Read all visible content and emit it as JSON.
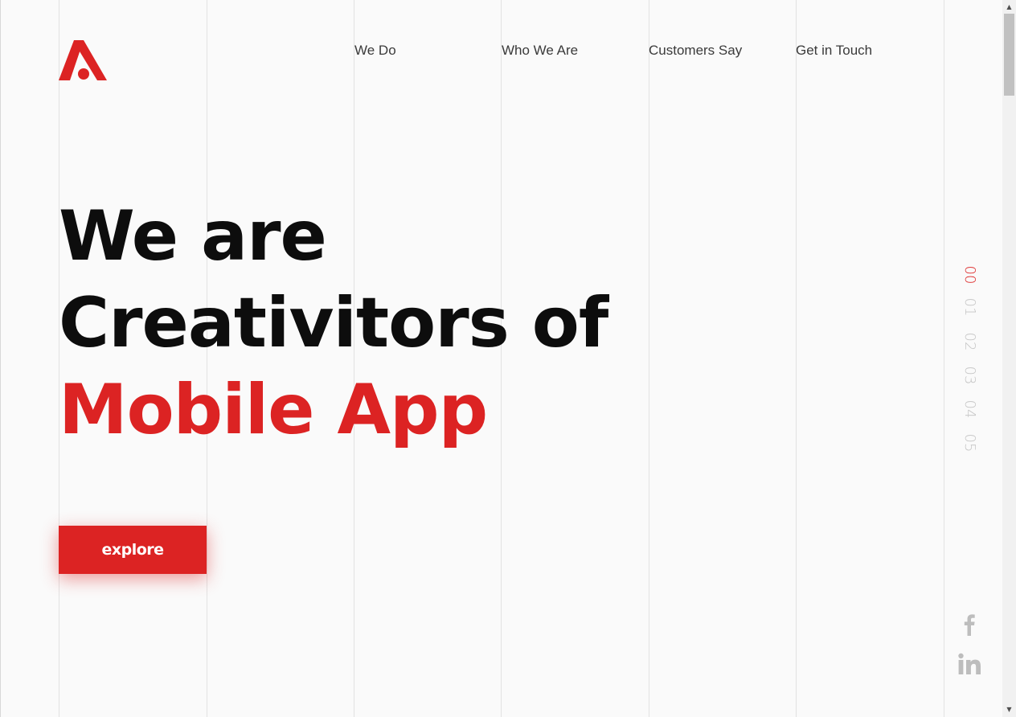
{
  "brand": {
    "logo_icon": "creativitors-a-logo",
    "accent_color": "#dc2323"
  },
  "nav": {
    "items": [
      {
        "label": "We Do"
      },
      {
        "label": "Who We Are"
      },
      {
        "label": "Customers Say"
      },
      {
        "label": "Get in Touch"
      }
    ]
  },
  "hero": {
    "line1": "We are",
    "line2": "Creativitors of",
    "line3": "Mobile App",
    "cta_label": "explore"
  },
  "pager": {
    "items": [
      "00",
      "01",
      "02",
      "03",
      "04",
      "05"
    ],
    "active_index": 0
  },
  "social": {
    "icons": [
      "facebook-icon",
      "linkedin-icon"
    ]
  },
  "colors": {
    "background": "#fafafa",
    "text": "#0d0d0d",
    "accent": "#dc2323",
    "muted": "#c4c4c4"
  }
}
